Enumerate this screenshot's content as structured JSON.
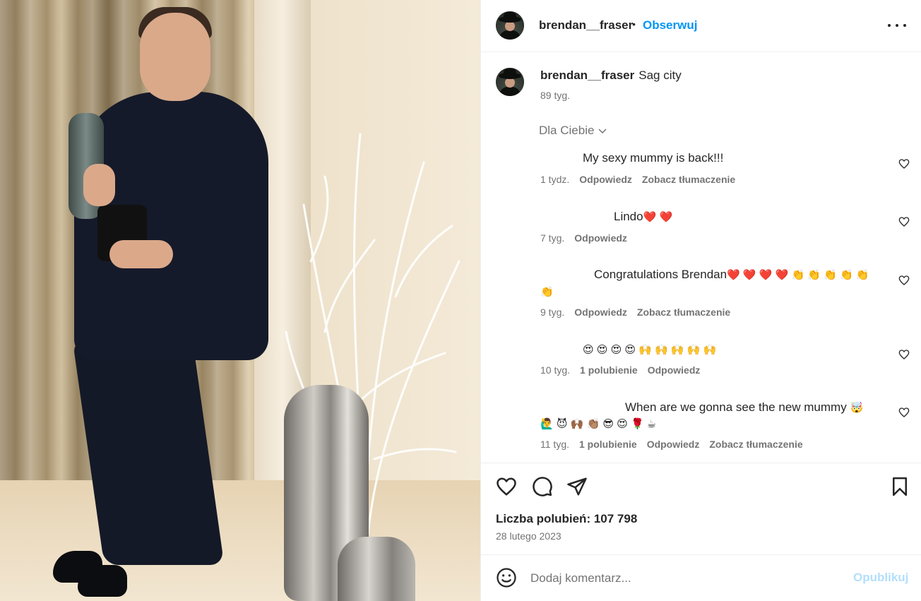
{
  "header": {
    "username": "brendan__fraser",
    "separator": "•",
    "follow_label": "Obserwuj",
    "more_icon": "more-horizontal-icon"
  },
  "caption": {
    "username": "brendan__fraser",
    "text": "Sag city",
    "time": "89 tyg."
  },
  "filter": {
    "label": "Dla Ciebie",
    "icon": "chevron-down-icon"
  },
  "comments": [
    {
      "text": "My sexy mummy is back!!!",
      "time": "1 tydz.",
      "likes": "",
      "reply": "Odpowiedz",
      "translate": "Zobacz tłumaczenie"
    },
    {
      "text": "Lindo",
      "emoji": "❤️ ❤️",
      "time": "7 tyg.",
      "likes": "",
      "reply": "Odpowiedz",
      "translate": ""
    },
    {
      "text": "Congratulations Brendan",
      "emoji": "❤️ ❤️ ❤️ ❤️ 👏 👏 👏 👏 👏",
      "emoji_line2": "👏",
      "time": "9 tyg.",
      "likes": "",
      "reply": "Odpowiedz",
      "translate": "Zobacz tłumaczenie"
    },
    {
      "text": "",
      "emoji": "😍 😍 😍 😍 🙌 🙌 🙌 🙌 🙌",
      "time": "10 tyg.",
      "likes": "1 polubienie",
      "reply": "Odpowiedz",
      "translate": ""
    },
    {
      "text": "When are we gonna see the new mummy",
      "emoji": "🤯",
      "emoji_line2": "🙋‍♂️ 😈 🙌🏾 👏🏽 😎 😍 🌹 ☕",
      "time": "11 tyg.",
      "likes": "1 polubienie",
      "reply": "Odpowiedz",
      "translate": "Zobacz tłumaczenie"
    }
  ],
  "actions": {
    "like_icon": "heart-icon",
    "comment_icon": "comment-icon",
    "share_icon": "send-icon",
    "save_icon": "bookmark-icon"
  },
  "likes_text": "Liczba polubień: 107 798",
  "date": "28 lutego 2023",
  "compose": {
    "placeholder": "Dodaj komentarz...",
    "publish_label": "Opublikuj",
    "emoji_icon": "smiley-icon"
  },
  "colors": {
    "accent": "#0095f6",
    "publish_disabled": "#b2dffc",
    "secondary_text": "#737373",
    "primary_text": "#262626",
    "divider": "#efefef"
  }
}
